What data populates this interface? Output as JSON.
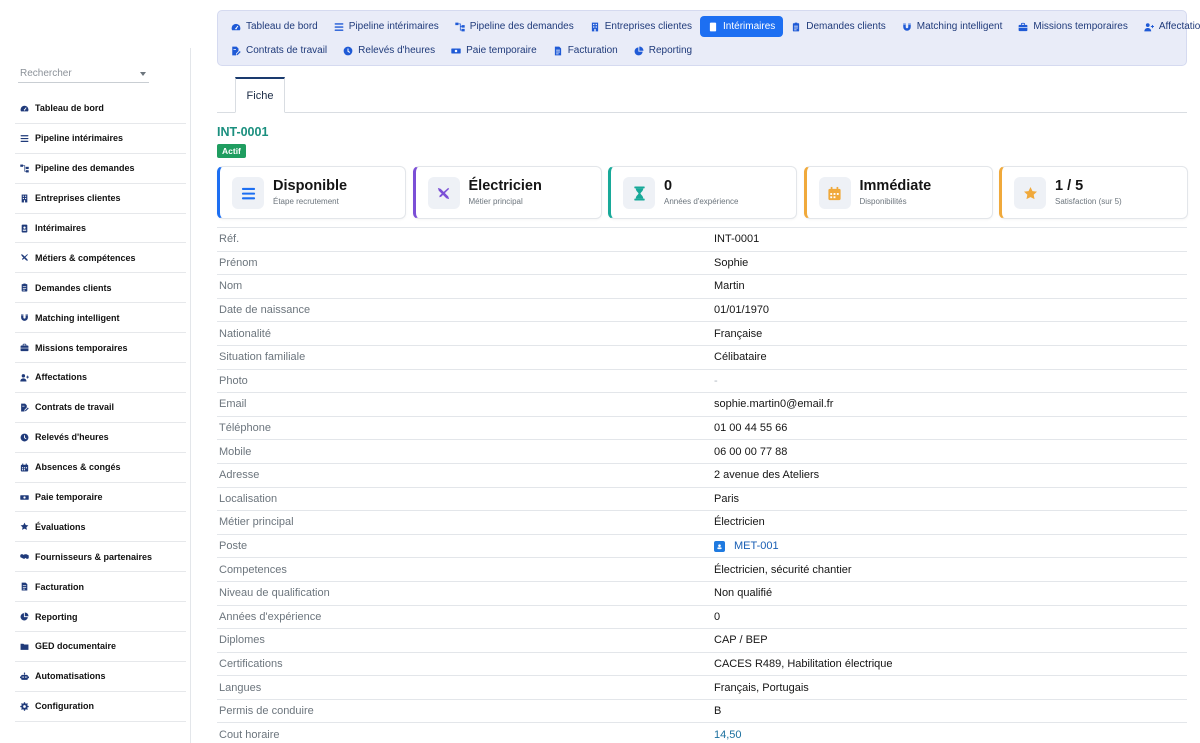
{
  "colors": {
    "accent": "#1d6ff2",
    "teal": "#1a8f7e",
    "success": "#1f9d60",
    "nav_text": "#1f3a7a"
  },
  "sidebar": {
    "search_placeholder": "Rechercher",
    "items": [
      {
        "label": "Tableau de bord",
        "icon": "gauge-icon"
      },
      {
        "label": "Pipeline intérimaires",
        "icon": "list-icon"
      },
      {
        "label": "Pipeline des demandes",
        "icon": "sitemap-icon"
      },
      {
        "label": "Entreprises clientes",
        "icon": "building-icon"
      },
      {
        "label": "Intérimaires",
        "icon": "id-badge-icon"
      },
      {
        "label": "Métiers & compétences",
        "icon": "tools-icon"
      },
      {
        "label": "Demandes clients",
        "icon": "clipboard-icon"
      },
      {
        "label": "Matching intelligent",
        "icon": "magnet-icon"
      },
      {
        "label": "Missions temporaires",
        "icon": "briefcase-icon"
      },
      {
        "label": "Affectations",
        "icon": "user-plus-icon"
      },
      {
        "label": "Contrats de travail",
        "icon": "file-signature-icon"
      },
      {
        "label": "Relevés d'heures",
        "icon": "clock-icon"
      },
      {
        "label": "Absences & congés",
        "icon": "calendar-icon"
      },
      {
        "label": "Paie temporaire",
        "icon": "money-icon"
      },
      {
        "label": "Évaluations",
        "icon": "star-icon"
      },
      {
        "label": "Fournisseurs & partenaires",
        "icon": "handshake-icon"
      },
      {
        "label": "Facturation",
        "icon": "invoice-icon"
      },
      {
        "label": "Reporting",
        "icon": "pie-chart-icon"
      },
      {
        "label": "GED documentaire",
        "icon": "folder-icon"
      },
      {
        "label": "Automatisations",
        "icon": "robot-icon"
      },
      {
        "label": "Configuration",
        "icon": "gear-icon"
      }
    ]
  },
  "topnav": {
    "row1": [
      {
        "label": "Tableau de bord",
        "icon": "gauge-icon",
        "active": false
      },
      {
        "label": "Pipeline intérimaires",
        "icon": "list-icon",
        "active": false
      },
      {
        "label": "Pipeline des demandes",
        "icon": "sitemap-icon",
        "active": false
      },
      {
        "label": "Entreprises clientes",
        "icon": "building-icon",
        "active": false
      },
      {
        "label": "Intérimaires",
        "icon": "id-badge-icon",
        "active": true
      },
      {
        "label": "Demandes clients",
        "icon": "clipboard-icon",
        "active": false
      },
      {
        "label": "Matching intelligent",
        "icon": "magnet-icon",
        "active": false
      },
      {
        "label": "Missions temporaires",
        "icon": "briefcase-icon",
        "active": false
      },
      {
        "label": "Affectations",
        "icon": "user-plus-icon",
        "active": false
      }
    ],
    "row2": [
      {
        "label": "Contrats de travail",
        "icon": "file-signature-icon",
        "active": false
      },
      {
        "label": "Relevés d'heures",
        "icon": "clock-icon",
        "active": false
      },
      {
        "label": "Paie temporaire",
        "icon": "money-icon",
        "active": false
      },
      {
        "label": "Facturation",
        "icon": "invoice-icon",
        "active": false
      },
      {
        "label": "Reporting",
        "icon": "pie-chart-icon",
        "active": false
      }
    ]
  },
  "tabs": {
    "fiche": "Fiche"
  },
  "record": {
    "id": "INT-0001",
    "status": "Actif"
  },
  "kpis": [
    {
      "value": "Disponible",
      "label": "Étape recrutement",
      "icon": "list-icon",
      "color": "#1d6ff2"
    },
    {
      "value": "Électricien",
      "label": "Métier principal",
      "icon": "tools-icon",
      "color": "#7b4fd6"
    },
    {
      "value": "0",
      "label": "Années d'expérience",
      "icon": "hourglass-icon",
      "color": "#18a999"
    },
    {
      "value": "Immédiate",
      "label": "Disponibilités",
      "icon": "calendar-icon",
      "color": "#f0a93b"
    },
    {
      "value": "1 / 5",
      "label": "Satisfaction (sur 5)",
      "icon": "star-icon",
      "color": "#f0a93b"
    }
  ],
  "details": [
    {
      "label": "Réf.",
      "value": "INT-0001"
    },
    {
      "label": "Prénom",
      "value": "Sophie"
    },
    {
      "label": "Nom",
      "value": "Martin"
    },
    {
      "label": "Date de naissance",
      "value": "01/01/1970"
    },
    {
      "label": "Nationalité",
      "value": "Française"
    },
    {
      "label": "Situation familiale",
      "value": "Célibataire"
    },
    {
      "label": "Photo",
      "value": "-"
    },
    {
      "label": "Email",
      "value": "sophie.martin0@email.fr"
    },
    {
      "label": "Téléphone",
      "value": "01 00 44 55 66"
    },
    {
      "label": "Mobile",
      "value": "06 00 00 77 88"
    },
    {
      "label": "Adresse",
      "value": "2 avenue des Ateliers"
    },
    {
      "label": "Localisation",
      "value": "Paris"
    },
    {
      "label": "Métier principal",
      "value": "Électricien"
    },
    {
      "label": "Poste",
      "value": "MET-001"
    },
    {
      "label": "Competences",
      "value": "Électricien, sécurité chantier"
    },
    {
      "label": "Niveau de qualification",
      "value": "Non qualifié"
    },
    {
      "label": "Années d'expérience",
      "value": "0"
    },
    {
      "label": "Diplomes",
      "value": "CAP / BEP"
    },
    {
      "label": "Certifications",
      "value": "CACES R489, Habilitation électrique"
    },
    {
      "label": "Langues",
      "value": "Français, Portugais"
    },
    {
      "label": "Permis de conduire",
      "value": "B"
    },
    {
      "label": "Cout horaire",
      "value": "14,50"
    }
  ]
}
